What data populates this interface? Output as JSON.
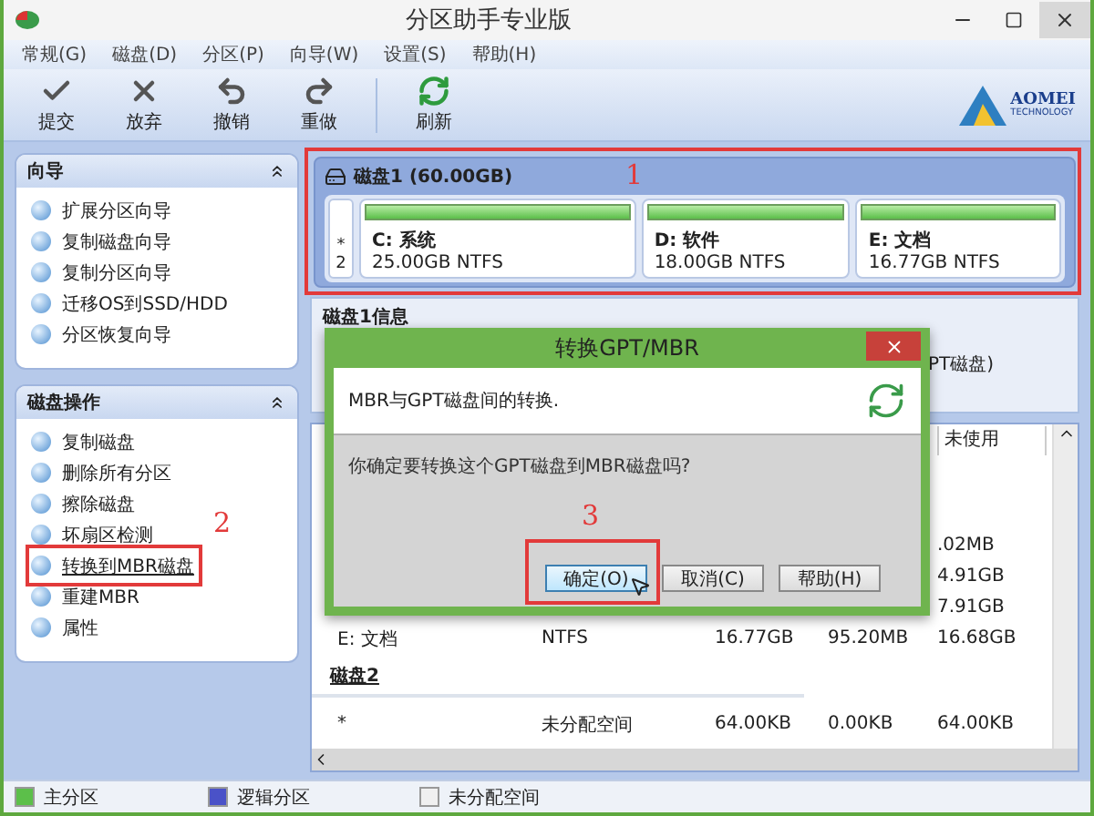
{
  "window": {
    "title": "分区助手专业版"
  },
  "menu": [
    "常规(G)",
    "磁盘(D)",
    "分区(P)",
    "向导(W)",
    "设置(S)",
    "帮助(H)"
  ],
  "toolbar": [
    {
      "kind": "check",
      "label": "提交"
    },
    {
      "kind": "cross",
      "label": "放弃"
    },
    {
      "kind": "undo",
      "label": "撤销"
    },
    {
      "kind": "redo",
      "label": "重做"
    },
    {
      "kind": "refresh",
      "label": "刷新"
    }
  ],
  "logo": {
    "name": "AOMEI",
    "tagline": "TECHNOLOGY"
  },
  "sidebar": [
    {
      "title": "向导",
      "expanded": true,
      "items": [
        {
          "label": "扩展分区向导",
          "hovered": false
        },
        {
          "label": "复制磁盘向导",
          "hovered": false
        },
        {
          "label": "复制分区向导",
          "hovered": false
        },
        {
          "label": "迁移OS到SSD/HDD",
          "hovered": false
        },
        {
          "label": "分区恢复向导",
          "hovered": false
        }
      ]
    },
    {
      "title": "磁盘操作",
      "expanded": true,
      "items": [
        {
          "label": "复制磁盘",
          "hovered": false
        },
        {
          "label": "删除所有分区",
          "hovered": false
        },
        {
          "label": "擦除磁盘",
          "hovered": false
        },
        {
          "label": "坏扇区检测",
          "hovered": false
        },
        {
          "label": "转换到MBR磁盘",
          "hovered": true,
          "annotation": "2"
        },
        {
          "label": "重建MBR",
          "hovered": false
        },
        {
          "label": "属性",
          "hovered": false
        }
      ]
    }
  ],
  "disk_map": {
    "title": "磁盘1 (60.00GB)",
    "annotation": "1",
    "unallocated": {
      "mark": "*",
      "number": "2"
    },
    "partitions": [
      {
        "name": "C: 系统",
        "size": "25.00GB NTFS",
        "kind": "primary"
      },
      {
        "name": "D: 软件",
        "size": "18.00GB NTFS",
        "kind": "primary"
      },
      {
        "name": "E: 文档",
        "size": "16.77GB NTFS",
        "kind": "primary"
      }
    ]
  },
  "info": {
    "title": "磁盘1信息",
    "text": "PT磁盘)"
  },
  "table": {
    "columns": [
      "未使用"
    ],
    "rows": [
      {
        "kind": "row",
        "unused": ".02MB"
      },
      {
        "kind": "row",
        "unused": "4.91GB"
      },
      {
        "kind": "row",
        "unused": "7.91GB"
      },
      {
        "kind": "row",
        "name": "E: 文档",
        "fs": "NTFS",
        "capacity": "16.77GB",
        "used": "95.20MB",
        "unused": "16.68GB"
      },
      {
        "kind": "group",
        "name": "磁盘2"
      },
      {
        "kind": "row",
        "name": "*",
        "fs": "未分配空间",
        "capacity": "64.00KB",
        "used": "0.00KB",
        "unused": "64.00KB"
      }
    ]
  },
  "dialog": {
    "title": "转换GPT/MBR",
    "heading": "MBR与GPT磁盘间的转换.",
    "question": "你确定要转换这个GPT磁盘到MBR磁盘吗?",
    "buttons": [
      {
        "label": "确定(O)",
        "selected": true,
        "annotation": "3"
      },
      {
        "label": "取消(C)",
        "selected": false
      },
      {
        "label": "帮助(H)",
        "selected": false
      }
    ]
  },
  "legend": [
    {
      "label": "主分区",
      "color": "#5cbf4a"
    },
    {
      "label": "逻辑分区",
      "color": "#4a52c8"
    },
    {
      "label": "未分配空间",
      "color": "#f0f0f0"
    }
  ]
}
